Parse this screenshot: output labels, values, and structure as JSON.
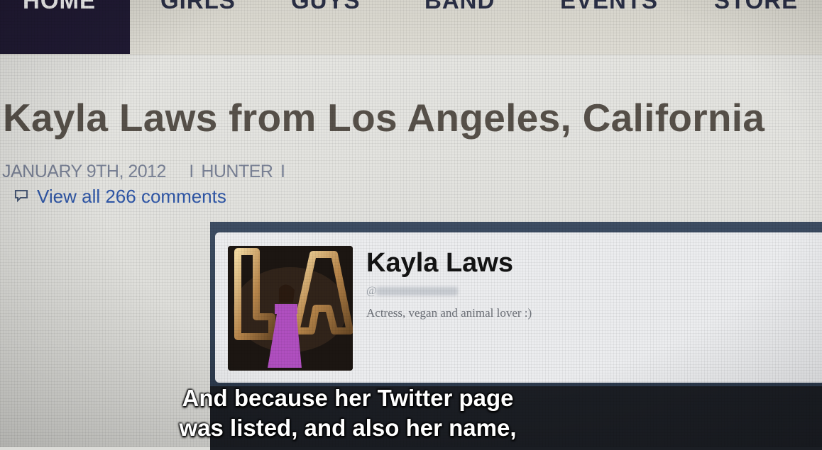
{
  "nav": {
    "items": [
      "HOME",
      "GIRLS",
      "GUYS",
      "BAND",
      "EVENTS",
      "STORE"
    ],
    "active": "HOME"
  },
  "article": {
    "title": "Kayla Laws from Los Angeles, California",
    "date": "JANUARY 9TH, 2012",
    "author": "HUNTER",
    "comments_link": "View all 266 comments"
  },
  "twitter_card": {
    "name": "Kayla Laws",
    "handle_prefix": "@",
    "bio": "Actress, vegan and animal lover :)"
  },
  "subtitle": {
    "line1": "And because her Twitter page",
    "line2": "was listed, and also her name,"
  },
  "colors": {
    "nav_active_bg": "#201a33",
    "link": "#2f57a8",
    "title": "#57514a"
  }
}
